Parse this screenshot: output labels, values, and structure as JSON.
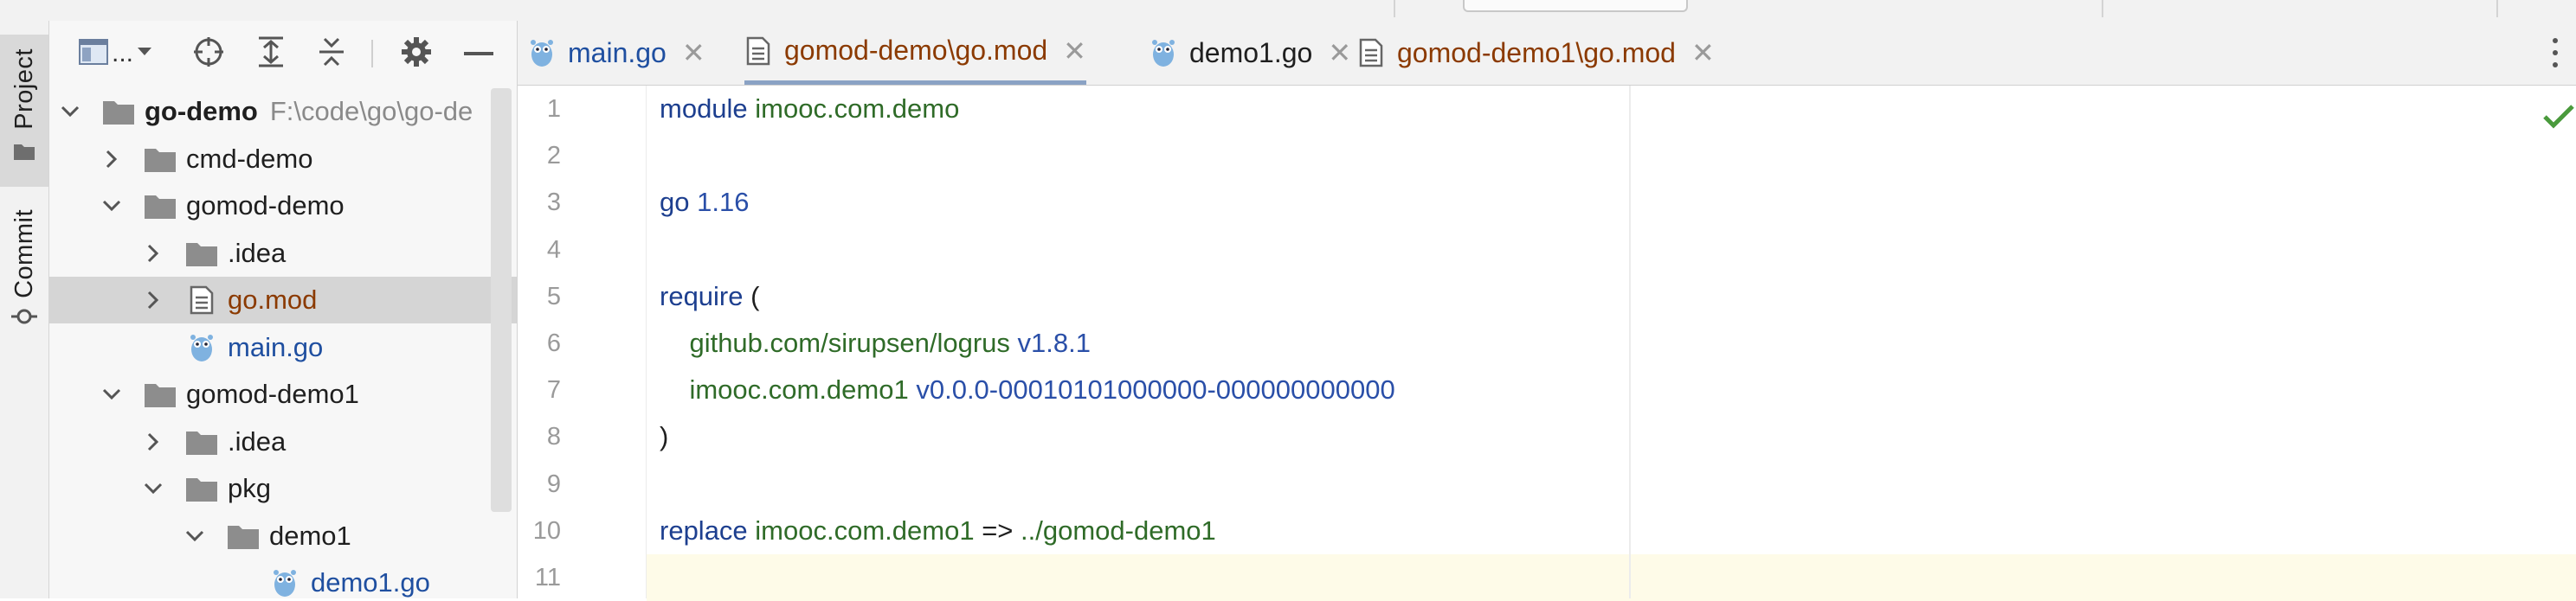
{
  "panel": {
    "vertical_tabs": [
      {
        "label": "Project"
      },
      {
        "label": "Commit"
      }
    ],
    "toolbar": {
      "view_select_label": "..."
    },
    "tree": [
      {
        "name": "go-demo",
        "path": "F:\\code\\go\\go-de",
        "depth": 0,
        "expanded": true,
        "type": "folder",
        "bold": true
      },
      {
        "name": "cmd-demo",
        "depth": 1,
        "expanded": false,
        "type": "folder"
      },
      {
        "name": "gomod-demo",
        "depth": 1,
        "expanded": true,
        "type": "folder"
      },
      {
        "name": ".idea",
        "depth": 2,
        "expanded": false,
        "type": "folder"
      },
      {
        "name": "go.mod",
        "depth": 2,
        "expanded": false,
        "type": "mod",
        "selected": true
      },
      {
        "name": "main.go",
        "depth": 2,
        "type": "go"
      },
      {
        "name": "gomod-demo1",
        "depth": 1,
        "expanded": true,
        "type": "folder"
      },
      {
        "name": ".idea",
        "depth": 2,
        "expanded": false,
        "type": "folder"
      },
      {
        "name": "pkg",
        "depth": 2,
        "expanded": true,
        "type": "folder"
      },
      {
        "name": "demo1",
        "depth": 3,
        "expanded": true,
        "type": "folder"
      },
      {
        "name": "demo1.go",
        "depth": 4,
        "type": "go"
      }
    ]
  },
  "tabs": [
    {
      "label": "main.go",
      "type": "go"
    },
    {
      "label": "gomod-demo\\go.mod",
      "type": "mod",
      "active": true
    },
    {
      "label": "demo1.go",
      "type": "go-plain"
    },
    {
      "label": "gomod-demo1\\go.mod",
      "type": "mod"
    }
  ],
  "tab_close_glyph": "✕",
  "editor": {
    "line_numbers": [
      "1",
      "2",
      "3",
      "4",
      "5",
      "6",
      "7",
      "8",
      "9",
      "10",
      "11"
    ],
    "lines": [
      [
        {
          "t": "module ",
          "c": "kw"
        },
        {
          "t": "imooc.com.demo",
          "c": "mod"
        }
      ],
      [],
      [
        {
          "t": "go ",
          "c": "kw"
        },
        {
          "t": "1.16",
          "c": "ver"
        }
      ],
      [],
      [
        {
          "t": "require ",
          "c": "kw"
        },
        {
          "t": "(",
          "c": "op"
        }
      ],
      [
        {
          "t": "    github.com/sirupsen/logrus ",
          "c": "mod"
        },
        {
          "t": "v1.8.1",
          "c": "ver"
        }
      ],
      [
        {
          "t": "    imooc.com.demo1 ",
          "c": "mod"
        },
        {
          "t": "v0.0.0-00010101000000-000000000000",
          "c": "ver"
        }
      ],
      [
        {
          "t": ")",
          "c": "op"
        }
      ],
      [],
      [
        {
          "t": "replace ",
          "c": "kw"
        },
        {
          "t": "imooc.com.demo1 ",
          "c": "mod"
        },
        {
          "t": "=> ",
          "c": "op"
        },
        {
          "t": "../gomod-demo1",
          "c": "mod"
        }
      ],
      []
    ],
    "current_line": 11
  },
  "colors": {
    "keyword": "#1d3f8f",
    "module": "#2f6b28",
    "version": "#2a4fa8",
    "mod_file": "#8b3a00",
    "go_file": "#1f4fa0",
    "current_line_bg": "#fefbe8",
    "selected_row_bg": "#d5d5d5",
    "ok_check": "#4a9a3c"
  }
}
